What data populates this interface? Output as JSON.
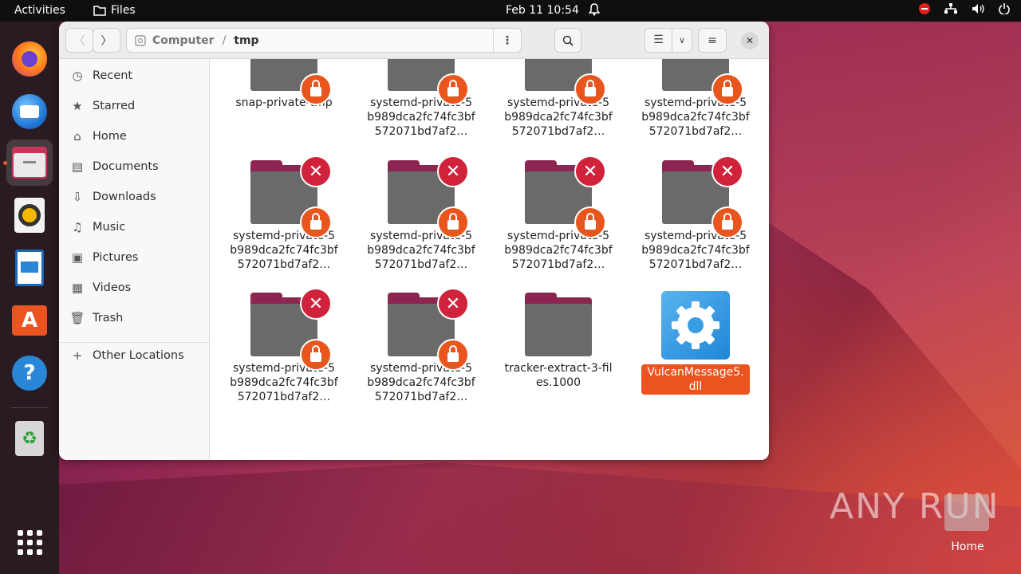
{
  "topbar": {
    "activities": "Activities",
    "app_name": "Files",
    "datetime": "Feb 11  10:54"
  },
  "dock": {
    "items": [
      "Firefox",
      "Thunderbird",
      "Files",
      "Rhythmbox",
      "LibreOffice Writer",
      "Ubuntu Software",
      "Help",
      "Trash"
    ]
  },
  "window": {
    "path": {
      "root": "Computer",
      "separator": "/",
      "current": "tmp"
    }
  },
  "sidebar": {
    "items": [
      {
        "label": "Recent",
        "icon": "clock-icon"
      },
      {
        "label": "Starred",
        "icon": "star-icon"
      },
      {
        "label": "Home",
        "icon": "home-icon"
      },
      {
        "label": "Documents",
        "icon": "document-icon"
      },
      {
        "label": "Downloads",
        "icon": "download-icon"
      },
      {
        "label": "Music",
        "icon": "music-icon"
      },
      {
        "label": "Pictures",
        "icon": "picture-icon"
      },
      {
        "label": "Videos",
        "icon": "video-icon"
      },
      {
        "label": "Trash",
        "icon": "trash-icon"
      }
    ],
    "other_locations": "Other Locations"
  },
  "files": [
    {
      "name": "snap-private-tmp",
      "x_emblem": false,
      "lock": true
    },
    {
      "name": "systemd-private-5b989dca2fc74fc3bf572071bd7af2…",
      "x_emblem": false,
      "lock": true
    },
    {
      "name": "systemd-private-5b989dca2fc74fc3bf572071bd7af2…",
      "x_emblem": false,
      "lock": true
    },
    {
      "name": "systemd-private-5b989dca2fc74fc3bf572071bd7af2…",
      "x_emblem": false,
      "lock": true
    },
    {
      "name": "systemd-private-5b989dca2fc74fc3bf572071bd7af2…",
      "x_emblem": true,
      "lock": true
    },
    {
      "name": "systemd-private-5b989dca2fc74fc3bf572071bd7af2…",
      "x_emblem": true,
      "lock": true
    },
    {
      "name": "systemd-private-5b989dca2fc74fc3bf572071bd7af2…",
      "x_emblem": true,
      "lock": true
    },
    {
      "name": "systemd-private-5b989dca2fc74fc3bf572071bd7af2…",
      "x_emblem": true,
      "lock": true
    },
    {
      "name": "systemd-private-5b989dca2fc74fc3bf572071bd7af2…",
      "x_emblem": true,
      "lock": true
    },
    {
      "name": "systemd-private-5b989dca2fc74fc3bf572071bd7af2…",
      "x_emblem": true,
      "lock": true
    },
    {
      "name": "tracker-extract-3-files.1000",
      "x_emblem": false,
      "lock": false
    },
    {
      "name": "VulcanMessage5.dll",
      "selected": true
    }
  ],
  "desktop": {
    "home_label": "Home",
    "watermark": "ANY RUN"
  },
  "colors": {
    "accent": "#e95420",
    "folder_tab": "#8c2650",
    "emblem_x": "#d0223a"
  }
}
